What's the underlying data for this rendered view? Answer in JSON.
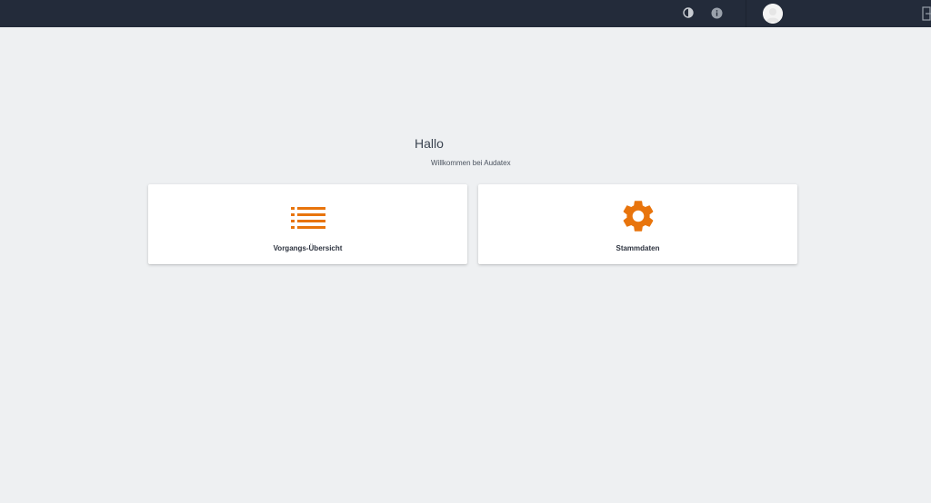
{
  "header": {
    "icons": [
      "contrast-icon",
      "info-icon",
      "avatar",
      "logout-icon"
    ]
  },
  "main": {
    "greeting": "Hallo",
    "welcome": "Willkommen bei Audatex"
  },
  "cards": [
    {
      "label": "Vorgangs-Übersicht",
      "icon": "list-icon"
    },
    {
      "label": "Stammdaten",
      "icon": "gear-icon"
    }
  ],
  "colors": {
    "topbar": "#232b3a",
    "background": "#eef0f2",
    "accent": "#e8740c"
  }
}
